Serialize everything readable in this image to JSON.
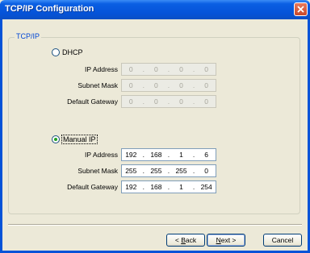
{
  "window": {
    "title": "TCP/IP Configuration",
    "close_icon": "close-icon"
  },
  "group": {
    "legend": "TCP/IP"
  },
  "dhcp": {
    "label": "DHCP",
    "selected": false,
    "fields": [
      {
        "label": "IP Address",
        "octets": [
          "0",
          "0",
          "0",
          "0"
        ]
      },
      {
        "label": "Subnet Mask",
        "octets": [
          "0",
          "0",
          "0",
          "0"
        ]
      },
      {
        "label": "Default Gateway",
        "octets": [
          "0",
          "0",
          "0",
          "0"
        ]
      }
    ]
  },
  "manual": {
    "label": "Manual IP",
    "selected": true,
    "fields": [
      {
        "label": "IP Address",
        "octets": [
          "192",
          "168",
          "1",
          "6"
        ]
      },
      {
        "label": "Subnet Mask",
        "octets": [
          "255",
          "255",
          "255",
          "0"
        ]
      },
      {
        "label": "Default Gateway",
        "octets": [
          "192",
          "168",
          "1",
          "254"
        ]
      }
    ]
  },
  "buttons": {
    "back_prefix": "< ",
    "back_mnemonic": "B",
    "back_rest": "ack",
    "next_mnemonic": "N",
    "next_rest": "ext >",
    "cancel": "Cancel"
  }
}
